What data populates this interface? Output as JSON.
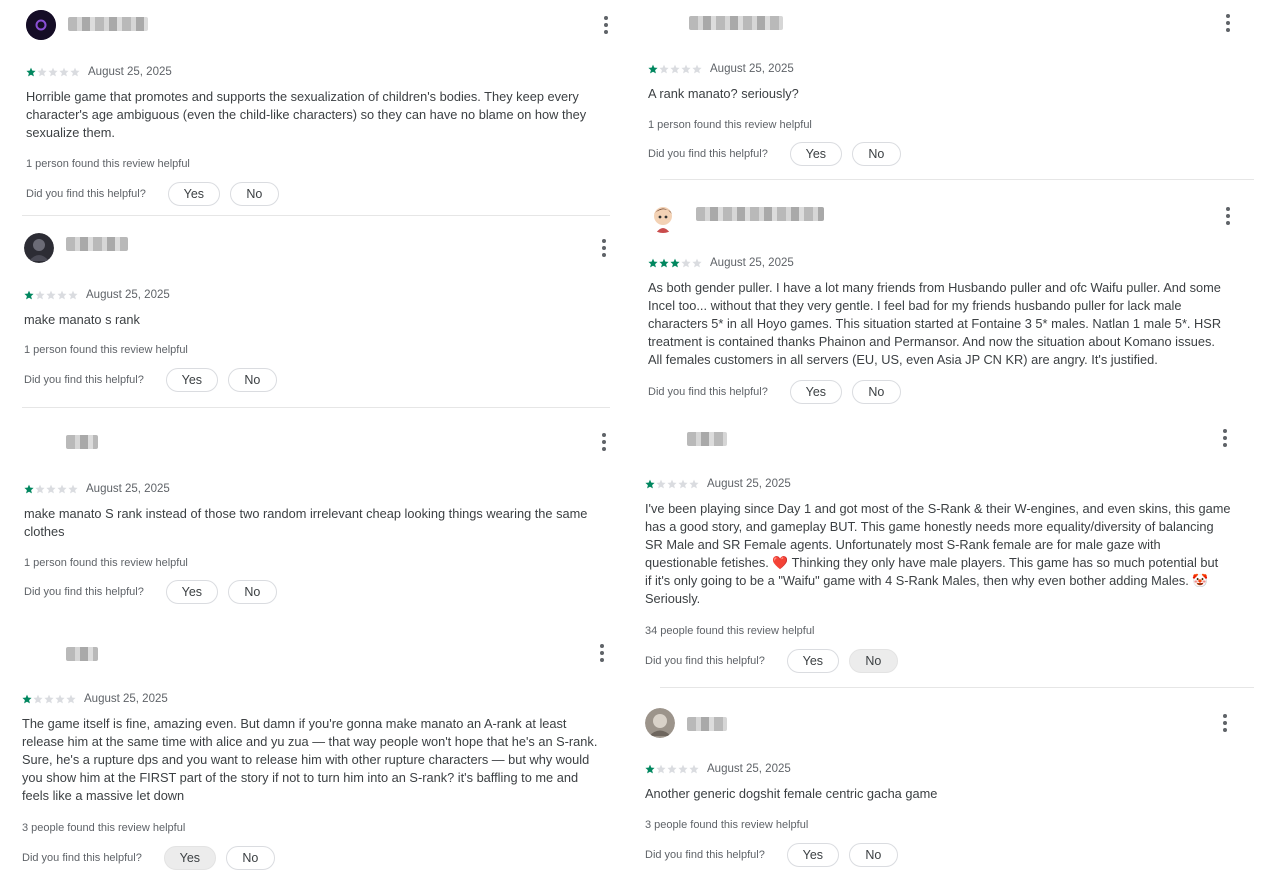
{
  "ui": {
    "ask_label": "Did you find this helpful?",
    "yes_label": "Yes",
    "no_label": "No",
    "more_options_icon": "more-vert-icon",
    "star_filled_color": "#01875f",
    "star_empty_color": "#dadce0"
  },
  "reviews": [
    {
      "rating": 1,
      "date": "August 25, 2025",
      "text": "Horrible game that promotes and supports the sexualization of children's bodies. They keep every\ncharacter's age ambiguous (even the child-like characters) so they can have no blame on how they\nsexualize them.",
      "helpful": "1 person found this review helpful",
      "selected": "none"
    },
    {
      "rating": 1,
      "date": "August 25, 2025",
      "text": "make manato s rank",
      "helpful": "1 person found this review helpful",
      "selected": "none"
    },
    {
      "rating": 1,
      "date": "August 25, 2025",
      "text": "make manato S rank instead of those two random irrelevant cheap looking things wearing the same\nclothes",
      "helpful": "1 person found this review helpful",
      "selected": "none"
    },
    {
      "rating": 1,
      "date": "August 25, 2025",
      "text": "The game itself is fine, amazing even. But damn if you're gonna make manato an A-rank at least\nrelease him at the same time with alice and yu zua — that way people won't hope that he's an S-rank.\nSure, he's a rupture dps and you want to release him with other rupture characters — but why would\nyou show him at the FIRST part of the story if not to turn him into an S-rank? it's baffling to me and\nfeels like a massive let down",
      "helpful": "3 people found this review helpful",
      "selected": "yes"
    },
    {
      "rating": 1,
      "date": "August 25, 2025",
      "text": "A rank manato? seriously?",
      "helpful": "1 person found this review helpful",
      "selected": "none"
    },
    {
      "rating": 3,
      "date": "August 25, 2025",
      "text": "As both gender puller. I have a lot many friends from Husbando puller and ofc Waifu puller. And some\nIncel too... without that they very gentle. I feel bad for my friends husbando puller for lack male\ncharacters 5* in all Hoyo games. This situation started at Fontaine 3 5* males. Natlan 1 male 5*. HSR\ntreatment is contained thanks Phainon and Permansor. And now the situation about Komano issues.\nAll females customers in all servers (EU, US, even Asia JP CN KR) are angry. It's justified.",
      "helpful": "",
      "selected": "none"
    },
    {
      "rating": 1,
      "date": "August 25, 2025",
      "text": "I've been playing since Day 1 and got most of the S-Rank & their W-engines, and even skins, this game\nhas a good story, and gameplay BUT. This game honestly needs more equality/diversity of balancing\nSR Male and SR Female agents. Unfortunately most S-Rank female are for male gaze with\nquestionable fetishes. ❤️ Thinking they only have male players. This game has so much potential but\nif it's only going to be a \"Waifu\" game with 4 S-Rank Males, then why even bother adding Males. 🤡\nSeriously.",
      "helpful": "34 people found this review helpful",
      "selected": "no"
    },
    {
      "rating": 1,
      "date": "August 25, 2025",
      "text": "Another generic dogshit female centric gacha game",
      "helpful": "3 people found this review helpful",
      "selected": "none"
    }
  ]
}
